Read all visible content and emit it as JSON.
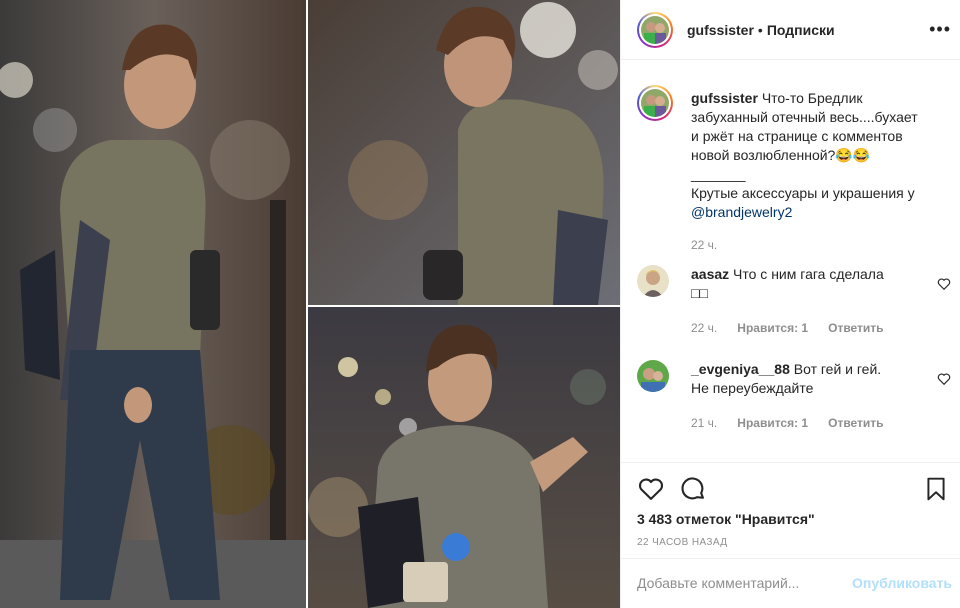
{
  "header": {
    "username": "gufssister",
    "separator": "•",
    "follow_label": "Подписки",
    "more": "•••"
  },
  "caption": {
    "username": "gufssister",
    "text_line1": "Что-то Бредлик",
    "text_line2": "забуханный отечный весь....бухает",
    "text_line3": "и ржёт на странице с комментов",
    "text_line4": "новой возлюбленной?😂😂",
    "divider": "_______",
    "promo": "Крутые аксессуары и украшения у",
    "mention": "@brandjewelry2",
    "time": "22 ч."
  },
  "comments": [
    {
      "username": "aasaz",
      "text": "Что с ним гага сделала",
      "glyphs": "□□",
      "time": "22 ч.",
      "likes": "Нравится: 1",
      "reply": "Ответить"
    },
    {
      "username": "_evgeniya__88",
      "text_line1": "Вот гей и гей.",
      "text_line2": "Не переубеждайте",
      "time": "21 ч.",
      "likes": "Нравится: 1",
      "reply": "Ответить"
    }
  ],
  "footer": {
    "likes_count": "3 483 отметок \"Нравится\"",
    "posted_ago": "22 ЧАСОВ НАЗАД",
    "comment_placeholder": "Добавьте комментарий...",
    "publish_label": "Опубликовать"
  },
  "icons": [
    "heart-icon",
    "comment-icon",
    "bookmark-icon",
    "more-icon"
  ],
  "colors": {
    "text": "#262626",
    "muted": "#8e8e8e",
    "link": "#003569",
    "publish_disabled": "#b2dffc",
    "border": "#efefef"
  }
}
